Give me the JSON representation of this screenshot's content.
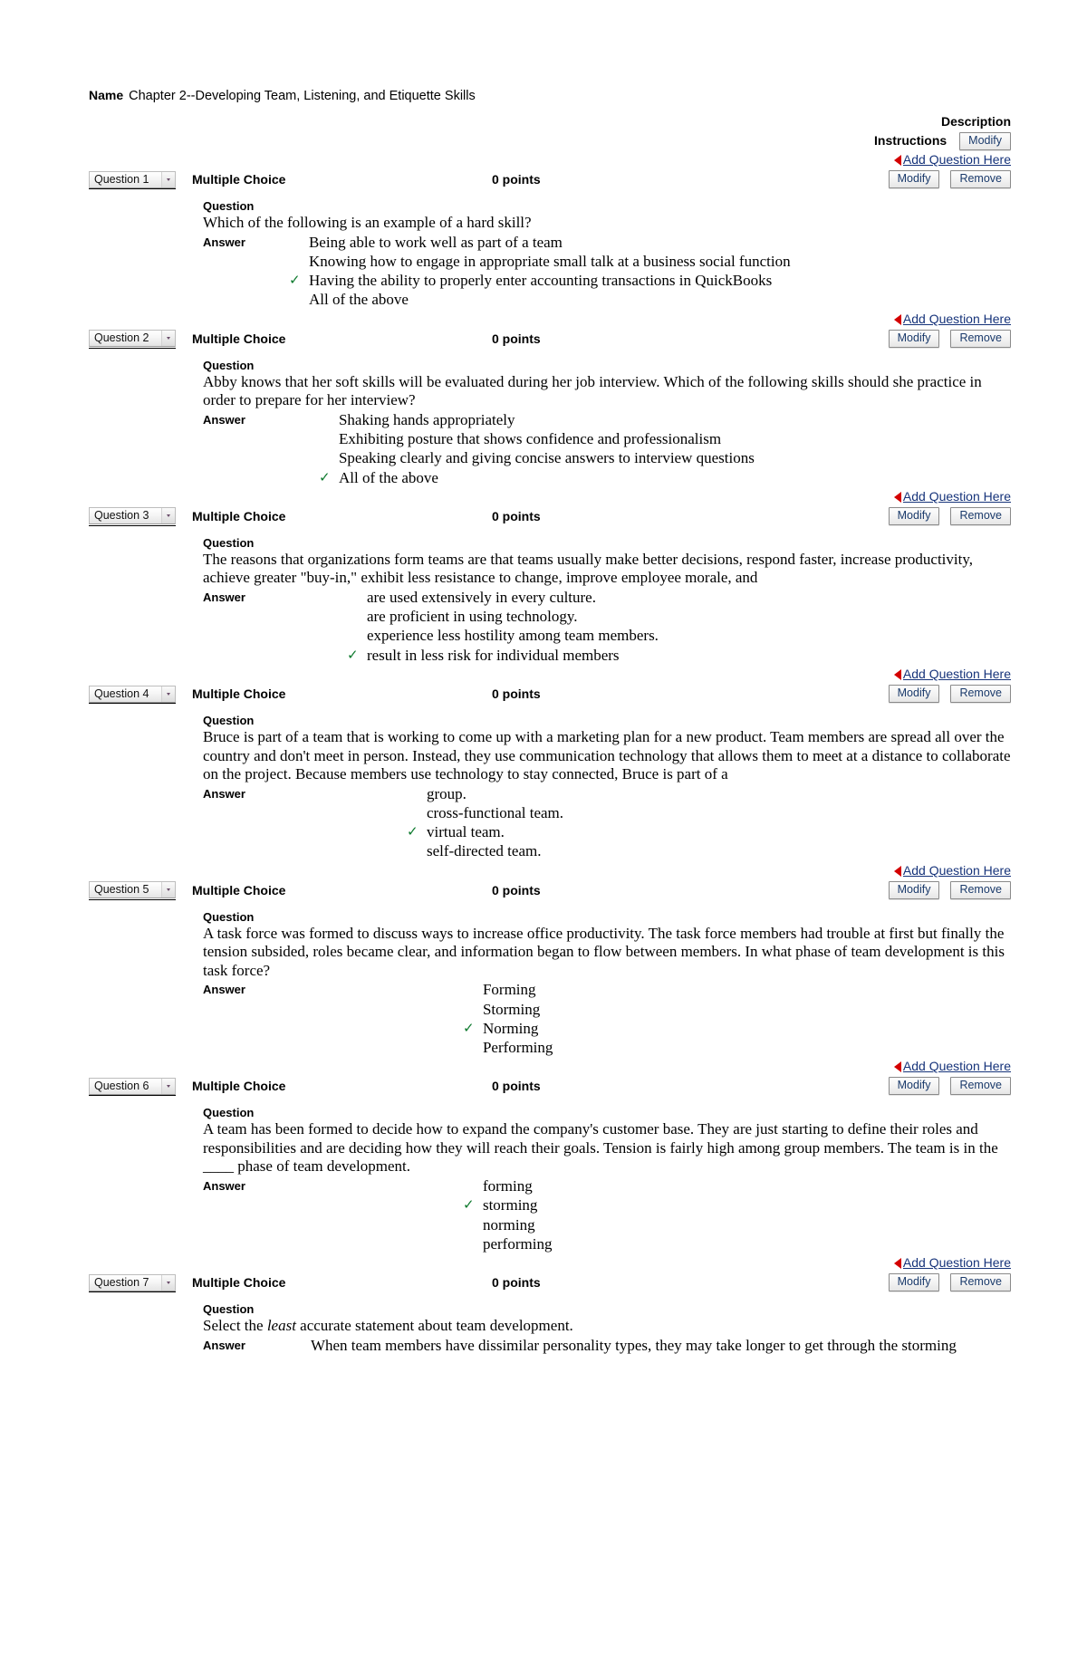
{
  "header": {
    "name_label": "Name",
    "name_value": "Chapter 2--Developing Team, Listening, and Etiquette Skills",
    "description_label": "Description",
    "instructions_label": "Instructions",
    "modify_label": "Modify"
  },
  "links": {
    "add_question_here": "Add Question Here"
  },
  "actions": {
    "modify": "Modify",
    "remove": "Remove"
  },
  "labels": {
    "question": "Question",
    "answer": "Answer",
    "type": "Multiple Choice",
    "points": "0 points"
  },
  "colors": {
    "link": "#16337a",
    "marker": "#d40000",
    "check": "#0e7a2e",
    "button_text": "#1a3a6b"
  },
  "questions": [
    {
      "selector": "Question 1",
      "type": "Multiple Choice",
      "points": "0 points",
      "stem": "Which of the following is an example of a hard skill?",
      "options_indent": 70,
      "options": [
        {
          "text": "Being able to work well as part of a team",
          "correct": false
        },
        {
          "text": "Knowing how to engage in appropriate small talk at a business social function",
          "correct": false
        },
        {
          "text": "Having the ability to properly enter accounting transactions in QuickBooks",
          "correct": true
        },
        {
          "text": "All of the above",
          "correct": false
        }
      ]
    },
    {
      "selector": "Question 2",
      "type": "Multiple Choice",
      "points": "0 points",
      "stem": "Abby knows that her soft skills will be evaluated during her job interview. Which of the following skills should she practice in order to prepare for her interview?",
      "options_indent": 103,
      "options": [
        {
          "text": "Shaking hands appropriately",
          "correct": false
        },
        {
          "text": "Exhibiting posture that shows confidence and professionalism",
          "correct": false
        },
        {
          "text": "Speaking clearly and giving concise answers to interview questions",
          "correct": false
        },
        {
          "text": "All of the above",
          "correct": true
        }
      ]
    },
    {
      "selector": "Question 3",
      "type": "Multiple Choice",
      "points": "0 points",
      "stem": "The reasons that organizations form teams are that teams usually make better decisions, respond faster, increase productivity, achieve greater \"buy-in,\" exhibit less resistance to change, improve employee morale, and",
      "options_indent": 134,
      "options": [
        {
          "text": "are used extensively in every culture.",
          "correct": false
        },
        {
          "text": "are proficient in using technology.",
          "correct": false
        },
        {
          "text": "experience less hostility among team members.",
          "correct": false
        },
        {
          "text": "result in less risk for individual members",
          "correct": true
        }
      ]
    },
    {
      "selector": "Question 4",
      "type": "Multiple Choice",
      "points": "0 points",
      "stem": "Bruce is part of a team that is working to come up with a marketing plan for a new product. Team members are spread all over the country and don't meet in person. Instead, they use communication technology that allows them to meet at a distance to collaborate on the project. Because members use technology to stay connected, Bruce is part of a",
      "options_indent": 200,
      "options": [
        {
          "text": "group.",
          "correct": false
        },
        {
          "text": "cross-functional team.",
          "correct": false
        },
        {
          "text": "virtual team.",
          "correct": true
        },
        {
          "text": "self-directed team.",
          "correct": false
        }
      ]
    },
    {
      "selector": "Question 5",
      "type": "Multiple Choice",
      "points": "0 points",
      "stem": "A task force was formed to discuss ways to increase office productivity. The task force members had trouble at first but finally the tension subsided, roles became clear, and information began to flow between members. In what phase of team development is this task force?",
      "options_indent": 262,
      "options": [
        {
          "text": "Forming",
          "correct": false
        },
        {
          "text": "Storming",
          "correct": false
        },
        {
          "text": "Norming",
          "correct": true
        },
        {
          "text": "Performing",
          "correct": false
        }
      ]
    },
    {
      "selector": "Question 6",
      "type": "Multiple Choice",
      "points": "0 points",
      "stem": "A team has been formed to decide how to expand the company's customer base. They are just starting to define their roles and responsibilities and are deciding how they will reach their goals. Tension is fairly high among group members. The team is in the ____ phase of team development.",
      "options_indent": 262,
      "options": [
        {
          "text": "forming",
          "correct": false
        },
        {
          "text": "storming",
          "correct": true
        },
        {
          "text": "norming",
          "correct": false
        },
        {
          "text": "performing",
          "correct": false
        }
      ]
    },
    {
      "selector": "Question 7",
      "type": "Multiple Choice",
      "points": "0 points",
      "stem_parts": [
        {
          "text": "Select the ",
          "italic": false
        },
        {
          "text": "least",
          "italic": true
        },
        {
          "text": " accurate statement about team development.",
          "italic": false
        }
      ],
      "options_indent": 72,
      "options": [
        {
          "text": "When team members have dissimilar personality types, they may take longer to get through the storming",
          "correct": false
        }
      ]
    }
  ]
}
